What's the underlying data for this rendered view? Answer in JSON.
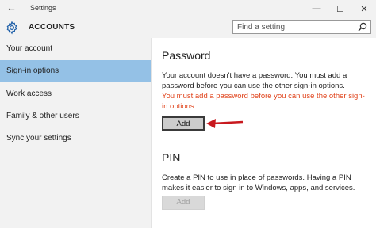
{
  "window": {
    "title": "Settings",
    "minimize_glyph": "—",
    "maximize_glyph": "☐",
    "close_glyph": "✕"
  },
  "header": {
    "title": "ACCOUNTS",
    "search_placeholder": "Find a setting"
  },
  "sidebar": {
    "items": [
      {
        "label": "Your account",
        "selected": false
      },
      {
        "label": "Sign-in options",
        "selected": true
      },
      {
        "label": "Work access",
        "selected": false
      },
      {
        "label": "Family & other users",
        "selected": false
      },
      {
        "label": "Sync your settings",
        "selected": false
      }
    ]
  },
  "password": {
    "title": "Password",
    "description": "Your account doesn't have a password. You must add a password before you can use the other sign-in options.",
    "warning": "You must add a password before you can use the other sign-in options.",
    "add_label": "Add"
  },
  "pin": {
    "title": "PIN",
    "description": "Create a PIN to use in place of passwords. Having a PIN makes it easier to sign in to Windows, apps, and services.",
    "add_label": "Add"
  },
  "colors": {
    "accent": "#1e5fa8",
    "selected_nav": "#94c1e6",
    "warning": "#e0431b",
    "arrow": "#c8191e"
  },
  "icons": [
    "back-icon",
    "gear-icon",
    "search-icon",
    "minimize-icon",
    "maximize-icon",
    "close-icon",
    "arrow-icon"
  ]
}
